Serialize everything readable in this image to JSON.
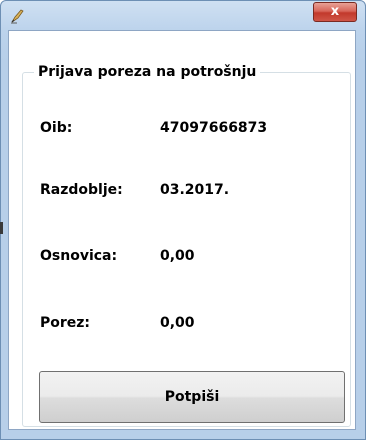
{
  "window": {
    "close_label": "x"
  },
  "form": {
    "group_title": "Prijava poreza na potrošnju",
    "rows": [
      {
        "label": "Oib:",
        "value": "47097666873"
      },
      {
        "label": "Razdoblje:",
        "value": "03.2017."
      },
      {
        "label": "Osnovica:",
        "value": "0,00"
      },
      {
        "label": "Porez:",
        "value": "0,00"
      }
    ],
    "sign_button_label": "Potpiši"
  },
  "icons": {
    "title_icon": "pen-feather-icon",
    "close_icon": "close-icon"
  },
  "colors": {
    "titlebar": "#bcd3ec",
    "close_button": "#c2392c",
    "content_background": "#ffffff"
  }
}
